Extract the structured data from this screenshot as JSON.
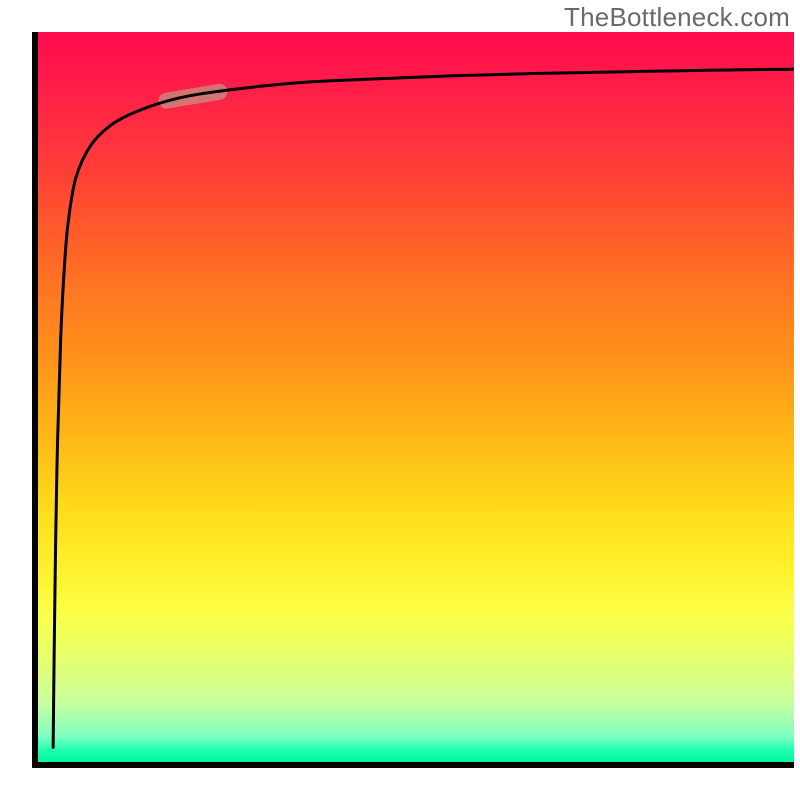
{
  "watermark": "TheBottleneck.com",
  "chart_data": {
    "type": "line",
    "title": "",
    "xlabel": "",
    "ylabel": "",
    "xlim": [
      0,
      100
    ],
    "ylim": [
      0,
      100
    ],
    "grid": false,
    "gradient_background": {
      "top_color": "#ff0a4e",
      "bottom_color": "#00f59b",
      "meaning": "top = high bottleneck (red), bottom = low bottleneck (green)"
    },
    "series": [
      {
        "name": "bottleneck-curve",
        "x": [
          2,
          2.2,
          2.5,
          3,
          3.5,
          4,
          5,
          7,
          10,
          14,
          18,
          22,
          28,
          35,
          45,
          55,
          65,
          75,
          85,
          95,
          100
        ],
        "y": [
          2,
          20,
          40,
          58,
          68,
          74,
          80,
          84.5,
          87.5,
          89.5,
          90.8,
          91.6,
          92.4,
          93.1,
          93.6,
          94.0,
          94.3,
          94.5,
          94.7,
          94.85,
          94.9
        ]
      }
    ],
    "highlight_segment": {
      "description": "pale capsule marking a segment on the curve",
      "x_range": [
        17,
        24
      ],
      "y_range": [
        90.6,
        91.8
      ]
    }
  }
}
